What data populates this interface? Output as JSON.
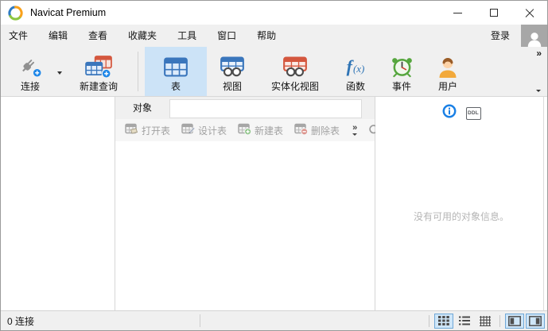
{
  "window": {
    "title": "Navicat Premium"
  },
  "menu_bar": {
    "items": [
      "文件",
      "编辑",
      "查看",
      "收藏夹",
      "工具",
      "窗口",
      "帮助"
    ],
    "login_label": "登录"
  },
  "toolbar": {
    "buttons": [
      {
        "label": "连接",
        "icon": "connection-plug-icon",
        "selected": false,
        "has_dropdown": true
      },
      {
        "label": "新建查询",
        "icon": "new-query-icon",
        "selected": false
      },
      {
        "label": "表",
        "icon": "table-icon",
        "selected": true
      },
      {
        "label": "视图",
        "icon": "view-icon",
        "selected": false
      },
      {
        "label": "实体化视图",
        "icon": "materialized-view-icon",
        "selected": false
      },
      {
        "label": "函数",
        "icon": "function-icon",
        "selected": false
      },
      {
        "label": "事件",
        "icon": "event-icon",
        "selected": false
      },
      {
        "label": "用户",
        "icon": "user-icon",
        "selected": false
      }
    ],
    "fx_main": "f",
    "fx_sub": "(x)",
    "overflow_glyph": "»"
  },
  "object_pane": {
    "tab_label": "对象",
    "actions": [
      {
        "label": "打开表",
        "icon": "open-table-icon",
        "enabled": false
      },
      {
        "label": "设计表",
        "icon": "design-table-icon",
        "enabled": false
      },
      {
        "label": "新建表",
        "icon": "new-table-icon",
        "enabled": false
      },
      {
        "label": "删除表",
        "icon": "delete-table-icon",
        "enabled": false
      }
    ],
    "overflow_glyph": "»"
  },
  "info_pane": {
    "icons": [
      "info-icon",
      "ddl-icon"
    ],
    "ddl_label": "DDL",
    "empty_message": "没有可用的对象信息。"
  },
  "status_bar": {
    "connections": "0 连接",
    "view_buttons": [
      "grid-view",
      "list-view",
      "detail-view",
      "toggle-left-pane",
      "toggle-right-pane"
    ],
    "selected_views": [
      "grid-view",
      "toggle-left-pane",
      "toggle-right-pane"
    ]
  },
  "icons": {
    "minimize": "thin horizontal bar",
    "maximize": "hollow square",
    "close": "diagonal cross",
    "dropdown": "small down triangle",
    "overflow": "»",
    "search": "magnifier",
    "info": "blue circled i",
    "avatar": "gray person silhouette"
  },
  "colors": {
    "chrome_bg": "#f0f0f0",
    "selected_button_bg": "#cce3f7",
    "table_blue": "#3a76bc",
    "table_red": "#d4573e",
    "add_badge_blue": "#1f87e8",
    "event_green": "#56a63e",
    "user_shirt_orange": "#f2a93b",
    "info_blue": "#1a80e5",
    "disabled_text": "#a2a2a2",
    "empty_text": "#b5b5b5",
    "status_selected_bg": "#cfe6f8",
    "status_selected_border": "#70a8d8",
    "border": "#d6d6d6"
  }
}
